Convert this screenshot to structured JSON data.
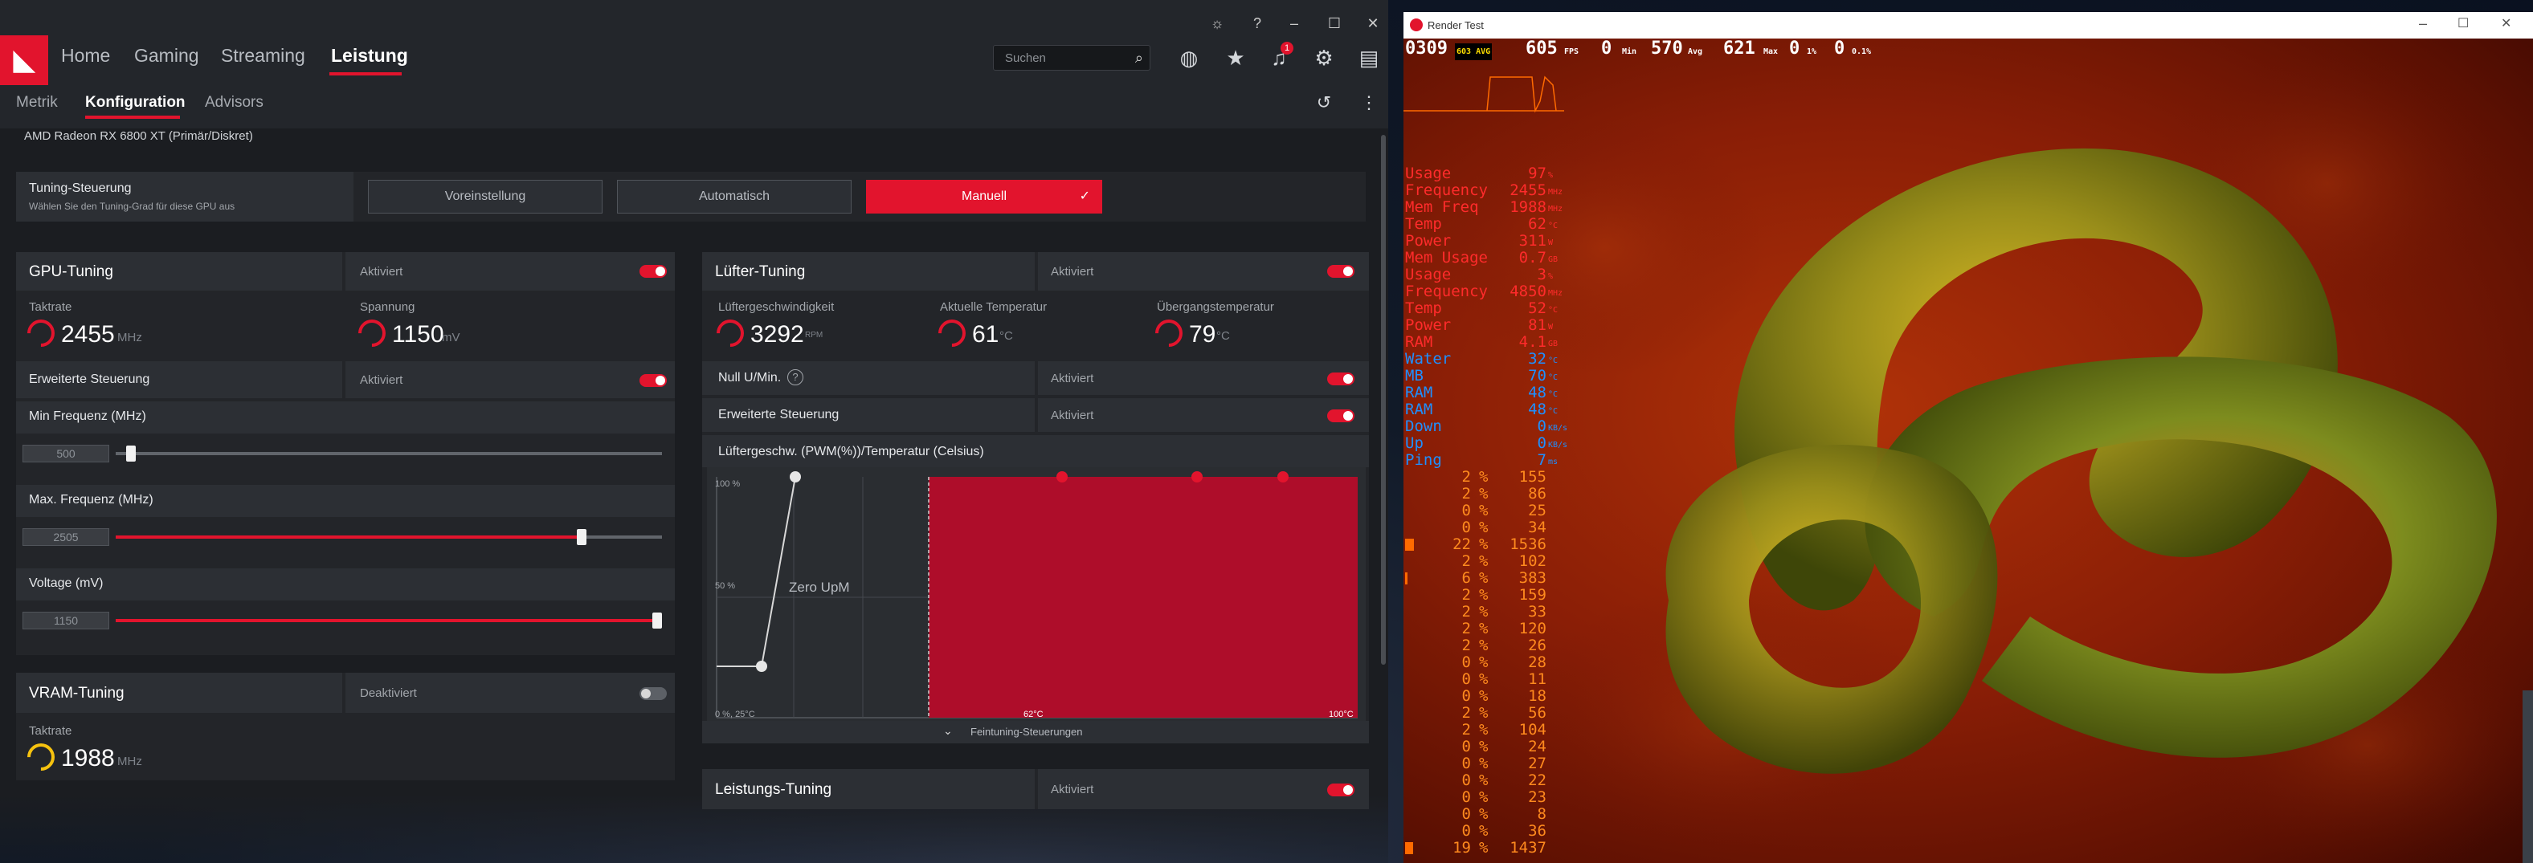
{
  "amd": {
    "nav": [
      "Home",
      "Gaming",
      "Streaming",
      "Leistung"
    ],
    "active_nav": "Leistung",
    "subnav": [
      "Metrik",
      "Konfiguration",
      "Advisors"
    ],
    "search_placeholder": "Suchen",
    "notification_count": "1",
    "gpu_name": "AMD Radeon RX 6800 XT (Primär/Diskret)",
    "tuning": {
      "title": "Tuning-Steuerung",
      "subtitle": "Wählen Sie den Tuning-Grad für diese GPU aus",
      "options": [
        "Voreinstellung",
        "Automatisch",
        "Manuell"
      ],
      "selected": "Manuell",
      "check": "✓"
    },
    "gpu_tuning": {
      "title": "GPU-Tuning",
      "status": "Aktiviert",
      "clock_label": "Taktrate",
      "clock_value": "2455",
      "clock_unit": "MHz",
      "voltage_label": "Spannung",
      "voltage_value": "1150",
      "voltage_unit": "mV",
      "adv_label": "Erweiterte Steuerung",
      "adv_status": "Aktiviert",
      "min_freq_label": "Min Frequenz (MHz)",
      "min_freq_value": "500",
      "min_freq_pos": 0.02,
      "max_freq_label": "Max. Frequenz (MHz)",
      "max_freq_value": "2505",
      "max_freq_pos": 0.86,
      "voltage_slider_label": "Voltage (mV)",
      "voltage_slider_value": "1150",
      "voltage_slider_pos": 1.0
    },
    "vram_tuning": {
      "title": "VRAM-Tuning",
      "status": "Deaktiviert",
      "clock_label": "Taktrate",
      "clock_value": "1988",
      "clock_unit": "MHz"
    },
    "fan_tuning": {
      "title": "Lüfter-Tuning",
      "status": "Aktiviert",
      "speed_label": "Lüftergeschwindigkeit",
      "speed_value": "3292",
      "speed_unit": "RPM",
      "temp_label": "Aktuelle Temperatur",
      "temp_value": "61",
      "temp_unit": "°C",
      "junction_label": "Übergangstemperatur",
      "junction_value": "79",
      "junction_unit": "°C",
      "zero_rpm_label": "Null U/Min.",
      "zero_rpm_status": "Aktiviert",
      "adv_label": "Erweiterte Steuerung",
      "adv_status": "Aktiviert",
      "curve_title": "Lüftergeschw. (PWM(%))/Temperatur (Celsius)",
      "y_top": "100 %",
      "y_mid": "50 %",
      "origin": "0 %, 25°C",
      "x_mid": "62°C",
      "x_max": "100°C",
      "zero_label": "Zero UpM",
      "fine_tuning": "Feintuning-Steuerungen"
    },
    "perf_tuning": {
      "title": "Leistungs-Tuning",
      "status": "Aktiviert"
    }
  },
  "render_test": {
    "title": "Render Test",
    "header": [
      {
        "t": "0309",
        "c": "#ffffff"
      },
      {
        "t": "603 AVG",
        "c": "#ffdf00",
        "s": 1
      },
      {
        "t": "605",
        "c": "#ffffff"
      },
      {
        "t": "FPS",
        "c": "#ffffff",
        "s": 1
      },
      {
        "t": "0",
        "c": "#ffffff"
      },
      {
        "t": "Min",
        "c": "#ffffff",
        "s": 1
      },
      {
        "t": "570",
        "c": "#ffffff"
      },
      {
        "t": "Avg",
        "c": "#ffffff",
        "s": 1
      },
      {
        "t": "621",
        "c": "#ffffff"
      },
      {
        "t": "Max",
        "c": "#ffffff",
        "s": 1
      },
      {
        "t": "0",
        "c": "#ffffff"
      },
      {
        "t": "1%",
        "c": "#ffffff",
        "s": 1
      },
      {
        "t": "0",
        "c": "#ffffff"
      },
      {
        "t": "0.1%",
        "c": "#ffffff",
        "s": 1
      }
    ],
    "stats": [
      {
        "label": "Usage",
        "value": "97",
        "unit": "%",
        "color": "#ff2b2b"
      },
      {
        "label": "Frequency",
        "value": "2455",
        "unit": "MHz",
        "color": "#ff2b2b"
      },
      {
        "label": "Mem Freq",
        "value": "1988",
        "unit": "MHz",
        "color": "#ff2b2b"
      },
      {
        "label": "Temp",
        "value": "62",
        "unit": "°C",
        "color": "#ff2b2b"
      },
      {
        "label": "Power",
        "value": "311",
        "unit": "W",
        "color": "#ff2b2b"
      },
      {
        "label": "Mem Usage",
        "value": "0.7",
        "unit": "GB",
        "color": "#ff2b2b"
      },
      {
        "label": "Usage",
        "value": "3",
        "unit": "%",
        "color": "#ff2b2b"
      },
      {
        "label": "Frequency",
        "value": "4850",
        "unit": "MHz",
        "color": "#ff2b2b"
      },
      {
        "label": "Temp",
        "value": "52",
        "unit": "°C",
        "color": "#ff2b2b"
      },
      {
        "label": "Power",
        "value": "81",
        "unit": "W",
        "color": "#ff2b2b"
      },
      {
        "label": "RAM",
        "value": "4.1",
        "unit": "GB",
        "color": "#ff2b2b"
      },
      {
        "label": "Water",
        "value": "32",
        "unit": "°C",
        "color": "#1e90ff"
      },
      {
        "label": "MB",
        "value": "70",
        "unit": "°C",
        "color": "#1e90ff"
      },
      {
        "label": "RAM",
        "value": "48",
        "unit": "°C",
        "color": "#1e90ff"
      },
      {
        "label": "RAM",
        "value": "48",
        "unit": "°C",
        "color": "#1e90ff"
      },
      {
        "label": "Down",
        "value": "0",
        "unit": "KB/s",
        "color": "#1e90ff"
      },
      {
        "label": "Up",
        "value": "0",
        "unit": "KB/s",
        "color": "#1e90ff"
      },
      {
        "label": "Ping",
        "value": "7",
        "unit": "ms",
        "color": "#1e90ff"
      }
    ],
    "cores": [
      [
        "2",
        "155"
      ],
      [
        "2",
        "86"
      ],
      [
        "0",
        "25"
      ],
      [
        "0",
        "34"
      ],
      [
        "22",
        "1536"
      ],
      [
        "2",
        "102"
      ],
      [
        "6",
        "383"
      ],
      [
        "2",
        "159"
      ],
      [
        "2",
        "33"
      ],
      [
        "2",
        "120"
      ],
      [
        "2",
        "26"
      ],
      [
        "0",
        "28"
      ],
      [
        "0",
        "11"
      ],
      [
        "0",
        "18"
      ],
      [
        "2",
        "56"
      ],
      [
        "2",
        "104"
      ],
      [
        "0",
        "24"
      ],
      [
        "0",
        "27"
      ],
      [
        "0",
        "22"
      ],
      [
        "0",
        "23"
      ],
      [
        "0",
        "8"
      ],
      [
        "0",
        "36"
      ],
      [
        "19",
        "1437"
      ]
    ],
    "core_unit": "%"
  }
}
